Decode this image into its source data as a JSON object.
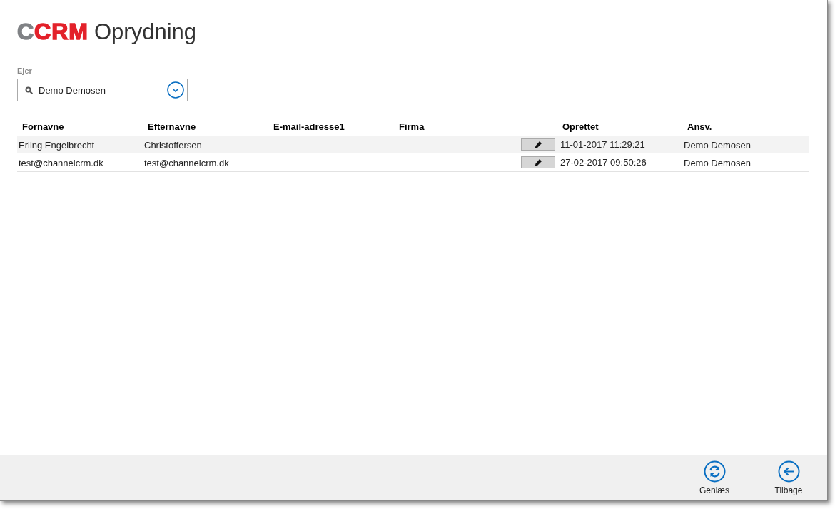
{
  "logo": {
    "part_1": "C",
    "part_2": "CRM"
  },
  "title": "Oprydning",
  "owner": {
    "label": "Ejer",
    "value": "Demo Demosen"
  },
  "table": {
    "columns": [
      "Fornavne",
      "Efternavne",
      "E-mail-adresse1",
      "Firma",
      "Oprettet",
      "Ansv."
    ],
    "rows": [
      {
        "selected": true,
        "cells": [
          "Erling Engelbrecht",
          "Christoffersen",
          "",
          "",
          "11-01-2017 11:29:21",
          "Demo Demosen"
        ]
      },
      {
        "selected": false,
        "cells": [
          "test@channelcrm.dk",
          "test@channelcrm.dk",
          "",
          "",
          "27-02-2017 09:50:26",
          "Demo Demosen"
        ]
      }
    ]
  },
  "footer": {
    "buttons": [
      {
        "kind": "refresh",
        "label": "Genlæs"
      },
      {
        "kind": "back",
        "label": "Tilbage"
      }
    ]
  }
}
